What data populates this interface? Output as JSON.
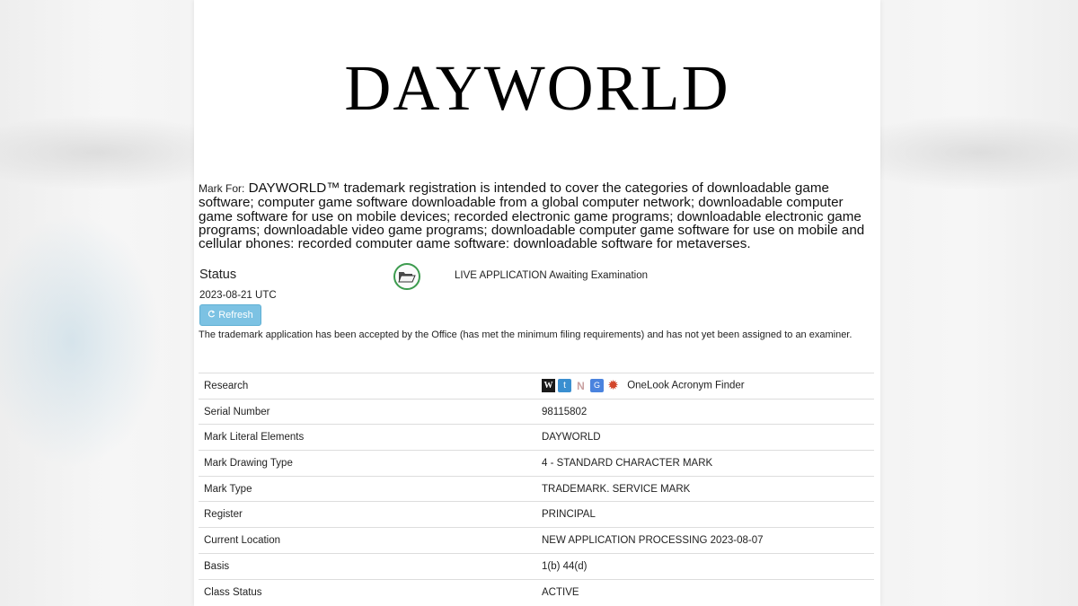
{
  "mark": {
    "image_text": "DAYWORLD"
  },
  "mark_for": {
    "label": "Mark For:",
    "text": "DAYWORLD™ trademark registration is intended to cover the categories of downloadable game software; computer game software downloadable from a global computer network; downloadable computer game software for use on mobile devices; recorded electronic game programs; downloadable electronic game programs; downloadable video game programs; downloadable computer game software for use on mobile and cellular phones; recorded computer game software; downloadable software for metaverses,"
  },
  "status": {
    "label": "Status",
    "icon": "open-folder-icon",
    "icon_color": "#3c9b4e",
    "text": "LIVE APPLICATION Awaiting Examination",
    "date": "2023-08-21 UTC",
    "refresh_label": "Refresh",
    "description": "The trademark application has been accepted by the Office (has met the minimum filing requirements) and has not yet been assigned to an examiner."
  },
  "details": {
    "research": {
      "key": "Research",
      "icons": {
        "wikipedia": "W",
        "twitter": "t",
        "netflix": "N",
        "translate": "G",
        "star": "✹"
      },
      "link": "OneLook Acronym Finder"
    },
    "rows": [
      {
        "key": "Serial Number",
        "value": "98115802"
      },
      {
        "key": "Mark Literal Elements",
        "value": "DAYWORLD"
      },
      {
        "key": "Mark Drawing Type",
        "value": "4 - STANDARD CHARACTER MARK"
      },
      {
        "key": "Mark Type",
        "value": "TRADEMARK. SERVICE MARK"
      },
      {
        "key": "Register",
        "value": "PRINCIPAL"
      },
      {
        "key": "Current Location",
        "value": "NEW APPLICATION PROCESSING 2023-08-07"
      },
      {
        "key": "Basis",
        "value": "1(b) 44(d)"
      },
      {
        "key": "Class Status",
        "value": "ACTIVE"
      }
    ]
  }
}
